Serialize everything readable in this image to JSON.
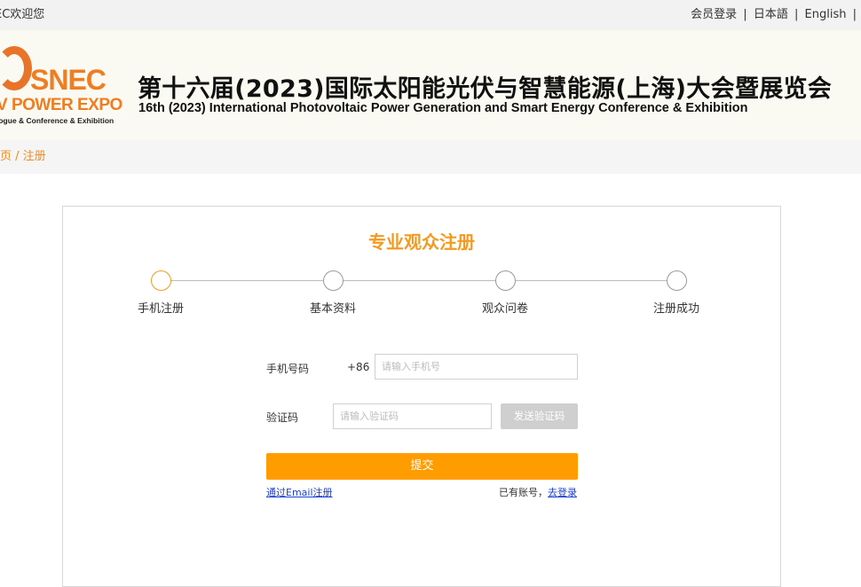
{
  "topbar": {
    "welcome": "EC欢迎您",
    "links": [
      "会员登录",
      "日本語",
      "English"
    ],
    "sep": "|"
  },
  "banner": {
    "logo": {
      "brand": "SNEC",
      "expo": "V POWER EXPO",
      "sub": "logue & Conference & Exhibition"
    },
    "title_cn": "第十六届(2023)国际太阳能光伏与智慧能源(上海)大会暨展览会",
    "title_en": "16th (2023) International Photovoltaic Power Generation and Smart Energy Conference & Exhibition"
  },
  "breadcrumb": {
    "text": "页 / 注册"
  },
  "form": {
    "title": "专业观众注册",
    "steps": [
      "手机注册",
      "基本资料",
      "观众问卷",
      "注册成功"
    ],
    "active_step": 0,
    "phone_label": "手机号码",
    "phone_prefix": "+86",
    "phone_placeholder": "请输入手机号",
    "code_label": "验证码",
    "code_placeholder": "请输入验证码",
    "send_code_label": "发送验证码",
    "submit_label": "提交",
    "email_register_link": "通过Email注册",
    "have_account_text": "已有账号，",
    "login_link": "去登录"
  },
  "colors": {
    "accent": "#ff9c00",
    "title": "#f39a1f",
    "link": "#1a3fd1"
  }
}
